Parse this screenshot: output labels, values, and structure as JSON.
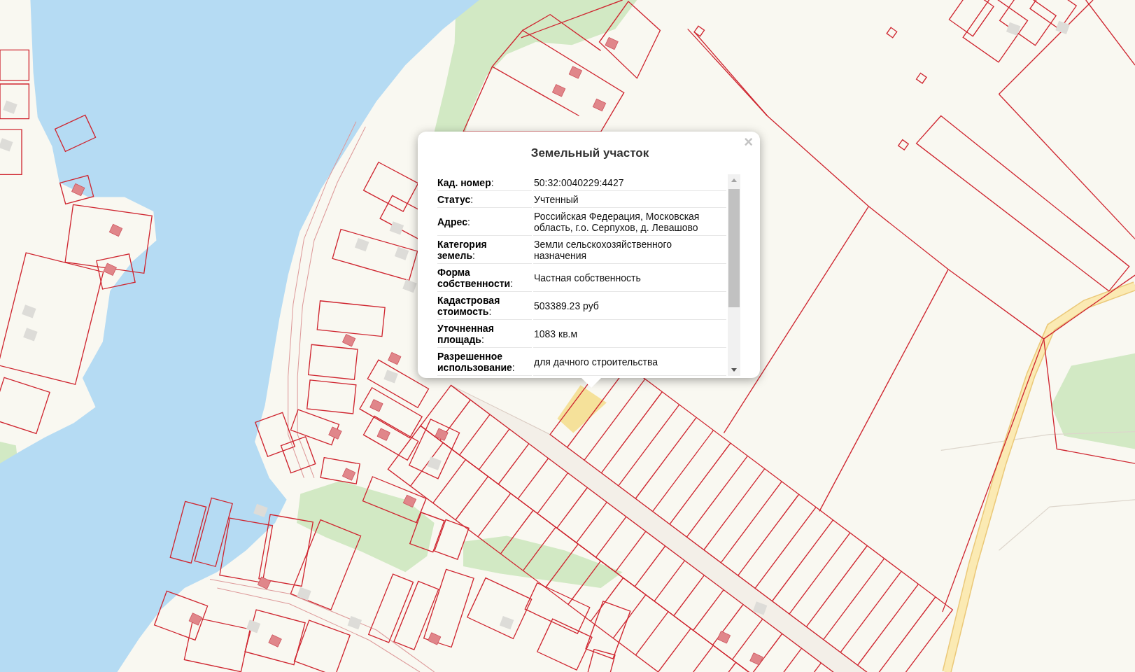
{
  "popup": {
    "title": "Земельный участок",
    "close": "×",
    "rows": [
      {
        "label": "**Кад. номер**:",
        "value": "50:32:0040229:4427"
      },
      {
        "label": "**Статус**:",
        "value": "Учтенный"
      },
      {
        "label": "**Адрес**:",
        "value": "Российская Федерация, Московская область, г.о. Серпухов, д. Левашово"
      },
      {
        "label": "**Категория земель**:",
        "value": "Земли сельскохозяйственного назначения"
      },
      {
        "label": "**Форма собственности**:",
        "value": "Частная собственность"
      },
      {
        "label": "**Кадастровая стоимость**:",
        "value": "503389.23 руб"
      },
      {
        "label": "**Уточненная площадь**:",
        "value": "1083 кв.м"
      },
      {
        "label": "**Разрешенное использование**:",
        "value": "для дачного строительства"
      }
    ]
  }
}
